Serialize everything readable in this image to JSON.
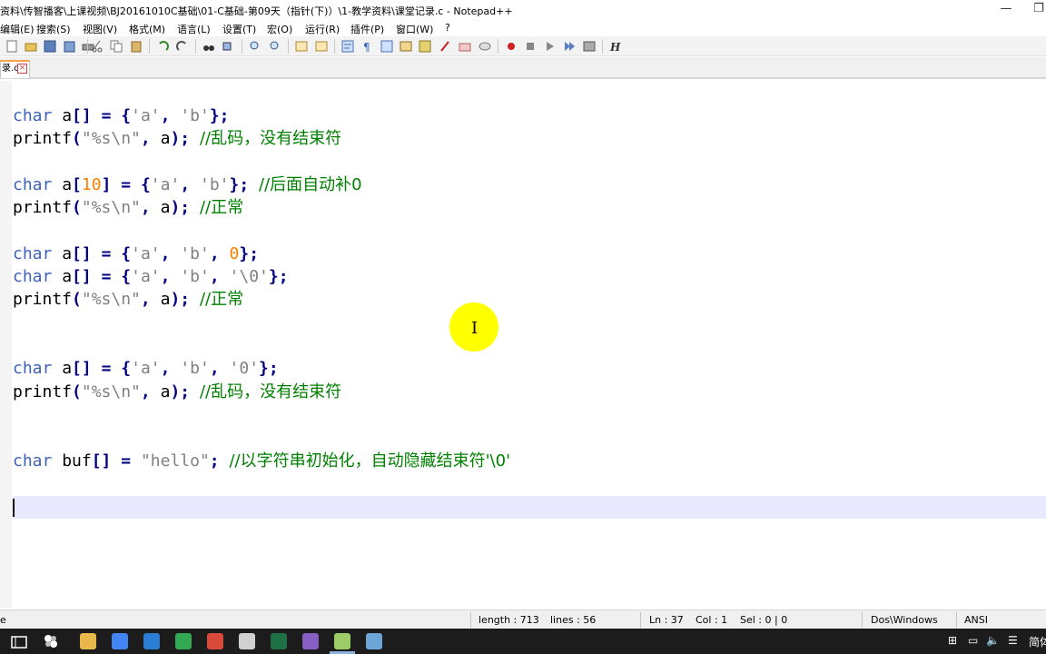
{
  "window": {
    "title": "资料\\传智播客\\上课视频\\BJ20161010C基础\\01-C基础-第09天（指针(下)）\\1-教学资料\\课堂记录.c - Notepad++",
    "minimize": "—",
    "restore": "❐"
  },
  "menu": [
    "编辑(E)",
    "搜索(S)",
    "视图(V)",
    "格式(M)",
    "语言(L)",
    "设置(T)",
    "宏(O)",
    "运行(R)",
    "插件(P)",
    "窗口(W)",
    "?"
  ],
  "tab": {
    "label": "录.c"
  },
  "code_lines": [
    {
      "row": 1,
      "tokens": [
        [
          "kw",
          "char"
        ],
        [
          "",
          "a"
        ],
        [
          "op",
          "[]"
        ],
        [
          "",
          ""
        ],
        [
          "op",
          "="
        ],
        [
          "",
          ""
        ],
        [
          "op",
          "{"
        ],
        [
          "str",
          "'a'"
        ],
        [
          "op",
          ","
        ],
        [
          "",
          ""
        ],
        [
          "str",
          "'b'"
        ],
        [
          "op",
          "};"
        ]
      ]
    },
    {
      "row": 2,
      "tokens": [
        [
          "",
          "printf"
        ],
        [
          "op",
          "("
        ],
        [
          "str",
          "\"%s\\n\""
        ],
        [
          "op",
          ","
        ],
        [
          "",
          ""
        ],
        [
          "",
          "a"
        ],
        [
          "op",
          ");"
        ],
        [
          "",
          ""
        ],
        [
          "cmt",
          "//乱码，没有结束符"
        ]
      ]
    },
    {
      "row": 4,
      "tokens": [
        [
          "kw",
          "char"
        ],
        [
          "",
          "a"
        ],
        [
          "op",
          "["
        ],
        [
          "num",
          "10"
        ],
        [
          "op",
          "]"
        ],
        [
          "",
          ""
        ],
        [
          "op",
          "="
        ],
        [
          "",
          ""
        ],
        [
          "op",
          "{"
        ],
        [
          "str",
          "'a'"
        ],
        [
          "op",
          ","
        ],
        [
          "",
          ""
        ],
        [
          "str",
          "'b'"
        ],
        [
          "op",
          "};"
        ],
        [
          "",
          ""
        ],
        [
          "cmt",
          "//后面自动补0"
        ]
      ]
    },
    {
      "row": 5,
      "tokens": [
        [
          "",
          "printf"
        ],
        [
          "op",
          "("
        ],
        [
          "str",
          "\"%s\\n\""
        ],
        [
          "op",
          ","
        ],
        [
          "",
          ""
        ],
        [
          "",
          "a"
        ],
        [
          "op",
          ");"
        ],
        [
          "",
          ""
        ],
        [
          "cmt",
          "//正常"
        ]
      ]
    },
    {
      "row": 7,
      "tokens": [
        [
          "kw",
          "char"
        ],
        [
          "",
          "a"
        ],
        [
          "op",
          "[]"
        ],
        [
          "",
          ""
        ],
        [
          "op",
          "="
        ],
        [
          "",
          ""
        ],
        [
          "op",
          "{"
        ],
        [
          "str",
          "'a'"
        ],
        [
          "op",
          ","
        ],
        [
          "",
          ""
        ],
        [
          "str",
          "'b'"
        ],
        [
          "op",
          ","
        ],
        [
          "",
          ""
        ],
        [
          "num",
          "0"
        ],
        [
          "op",
          "};"
        ]
      ]
    },
    {
      "row": 8,
      "tokens": [
        [
          "kw",
          "char"
        ],
        [
          "",
          "a"
        ],
        [
          "op",
          "[]"
        ],
        [
          "",
          ""
        ],
        [
          "op",
          "="
        ],
        [
          "",
          ""
        ],
        [
          "op",
          "{"
        ],
        [
          "str",
          "'a'"
        ],
        [
          "op",
          ","
        ],
        [
          "",
          ""
        ],
        [
          "str",
          "'b'"
        ],
        [
          "op",
          ","
        ],
        [
          "",
          ""
        ],
        [
          "str",
          "'\\0'"
        ],
        [
          "op",
          "};"
        ]
      ]
    },
    {
      "row": 9,
      "tokens": [
        [
          "",
          "printf"
        ],
        [
          "op",
          "("
        ],
        [
          "str",
          "\"%s\\n\""
        ],
        [
          "op",
          ","
        ],
        [
          "",
          ""
        ],
        [
          "",
          "a"
        ],
        [
          "op",
          ");"
        ],
        [
          "",
          ""
        ],
        [
          "cmt",
          "//正常"
        ]
      ]
    },
    {
      "row": 12,
      "tokens": [
        [
          "kw",
          "char"
        ],
        [
          "",
          "a"
        ],
        [
          "op",
          "[]"
        ],
        [
          "",
          ""
        ],
        [
          "op",
          "="
        ],
        [
          "",
          ""
        ],
        [
          "op",
          "{"
        ],
        [
          "str",
          "'a'"
        ],
        [
          "op",
          ","
        ],
        [
          "",
          ""
        ],
        [
          "str",
          "'b'"
        ],
        [
          "op",
          ","
        ],
        [
          "",
          ""
        ],
        [
          "str",
          "'0'"
        ],
        [
          "op",
          "};"
        ]
      ]
    },
    {
      "row": 13,
      "tokens": [
        [
          "",
          "printf"
        ],
        [
          "op",
          "("
        ],
        [
          "str",
          "\"%s\\n\""
        ],
        [
          "op",
          ","
        ],
        [
          "",
          ""
        ],
        [
          "",
          "a"
        ],
        [
          "op",
          ");"
        ],
        [
          "",
          ""
        ],
        [
          "cmt",
          "//乱码，没有结束符"
        ]
      ]
    },
    {
      "row": 16,
      "tokens": [
        [
          "kw",
          "char"
        ],
        [
          "",
          "buf"
        ],
        [
          "op",
          "[]"
        ],
        [
          "",
          ""
        ],
        [
          "op",
          "="
        ],
        [
          "",
          ""
        ],
        [
          "str",
          "\"hello\""
        ],
        [
          "op",
          ";"
        ],
        [
          "",
          ""
        ],
        [
          "cmt",
          "//以字符串初始化，自动隐藏结束符'\\0'"
        ]
      ]
    }
  ],
  "status": {
    "left": "e",
    "length": "length : 713",
    "lines": "lines : 56",
    "ln": "Ln : 37",
    "col": "Col : 1",
    "sel": "Sel : 0 | 0",
    "eol": "Dos\\Windows",
    "encoding": "ANSI"
  },
  "taskbar": {
    "tray_text": "简体",
    "apps": [
      {
        "icon": "file-explorer-icon",
        "color": "#e8b84a"
      },
      {
        "icon": "chrome-icon",
        "color": "#4285f4"
      },
      {
        "icon": "word-icon",
        "color": "#2b7cd3"
      },
      {
        "icon": "app-green-icon",
        "color": "#33a852"
      },
      {
        "icon": "app-red-icon",
        "color": "#d84a3a"
      },
      {
        "icon": "app-window-icon",
        "color": "#d0d0d0"
      },
      {
        "icon": "excel-icon",
        "color": "#1e7145"
      },
      {
        "icon": "visual-studio-icon",
        "color": "#865fc5"
      },
      {
        "icon": "notepadpp-icon",
        "color": "#9ccc65"
      },
      {
        "icon": "app-blue-icon",
        "color": "#6ea6d8"
      }
    ]
  }
}
